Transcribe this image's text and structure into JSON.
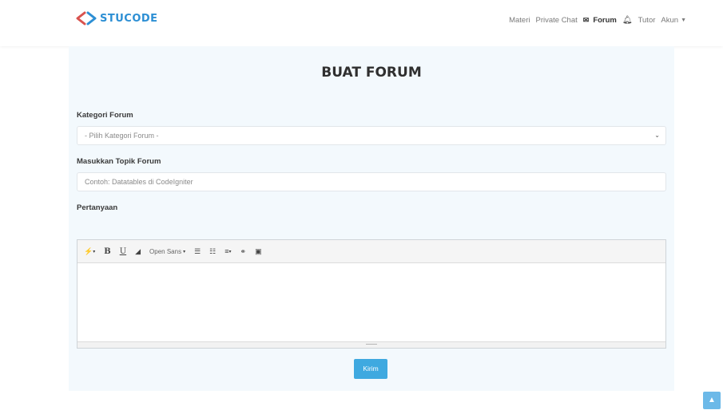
{
  "brand": {
    "name": "STUCODE"
  },
  "nav": {
    "materi": "Materi",
    "private_chat": "Private Chat",
    "forum": "Forum",
    "tutor": "Tutor",
    "akun": "Akun"
  },
  "form": {
    "title": "BUAT FORUM",
    "kategori_label": "Kategori Forum",
    "kategori_selected": "- Pilih Kategori Forum -",
    "topik_label": "Masukkan Topik Forum",
    "topik_placeholder": "Contoh: Datatables di CodeIgniter",
    "pertanyaan_label": "Pertanyaan",
    "editor_font": "Open Sans",
    "submit": "Kirim"
  },
  "colors": {
    "brand": "#2d8fd4",
    "button": "#3fa9e0",
    "panel": "#f3f9fd"
  }
}
